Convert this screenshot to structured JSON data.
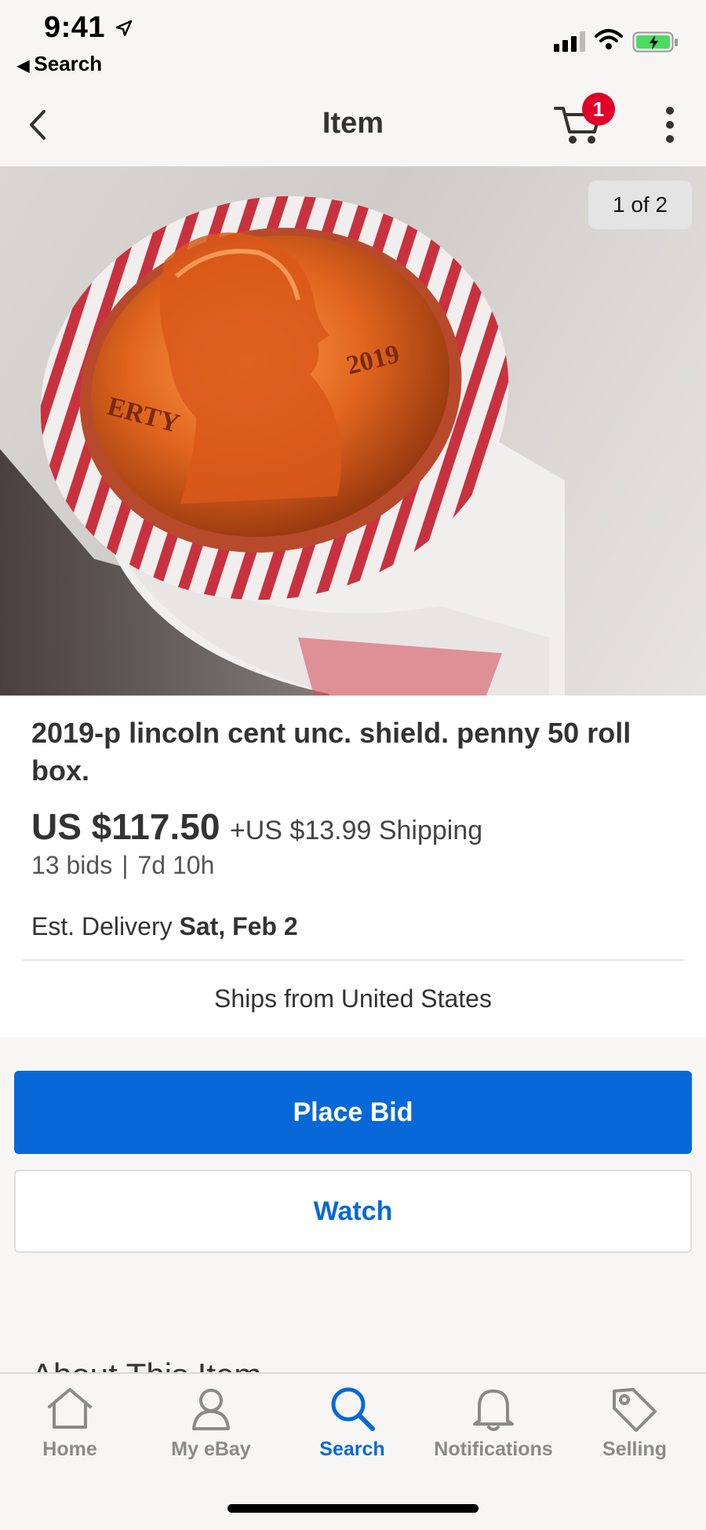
{
  "status_bar": {
    "time": "9:41",
    "back_app_label": "Search"
  },
  "nav": {
    "title": "Item",
    "cart_count": "1"
  },
  "gallery": {
    "counter": "1 of 2"
  },
  "item": {
    "title": "2019-p lincoln cent unc. shield. penny 50 roll box.",
    "price": "US $117.50",
    "shipping": "+US $13.99 Shipping",
    "bids": "13 bids",
    "separator": "|",
    "time_left": "7d 10h",
    "delivery_label": "Est. Delivery",
    "delivery_date": "Sat, Feb 2",
    "ships_from": "Ships from United States"
  },
  "actions": {
    "place_bid_label": "Place Bid",
    "watch_label": "Watch"
  },
  "section": {
    "about_heading": "About This Item"
  },
  "tab_bar": {
    "tabs": [
      {
        "label": "Home",
        "icon": "home-icon"
      },
      {
        "label": "My eBay",
        "icon": "person-icon"
      },
      {
        "label": "Search",
        "icon": "search-icon",
        "active": true
      },
      {
        "label": "Notifications",
        "icon": "bell-icon"
      },
      {
        "label": "Selling",
        "icon": "tag-icon"
      }
    ]
  },
  "colors": {
    "accent": "#0968d8",
    "badge": "#e0002a",
    "inactive_tab": "#8a8a8a"
  }
}
